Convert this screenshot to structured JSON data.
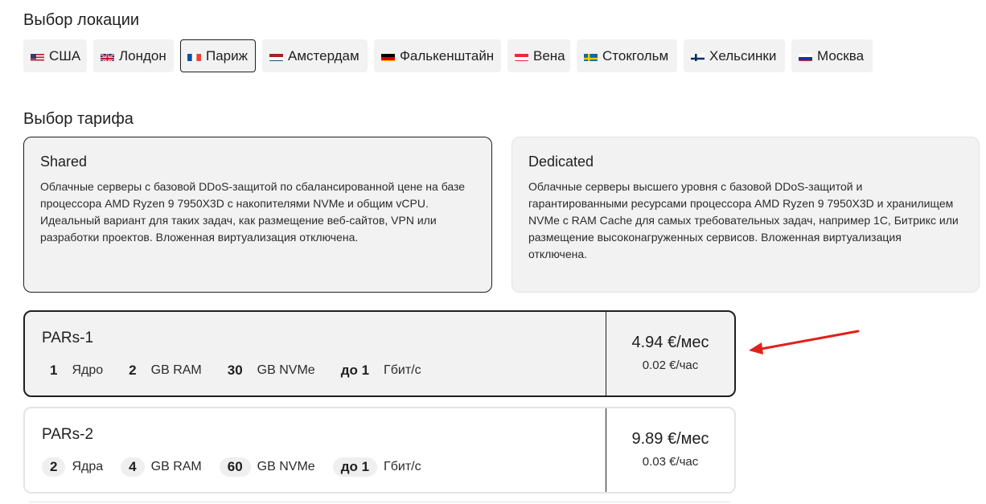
{
  "location_section": {
    "title": "Выбор локации",
    "items": [
      {
        "label": "США",
        "flag": "us-flag-icon"
      },
      {
        "label": "Лондон",
        "flag": "gb-flag-icon"
      },
      {
        "label": "Париж",
        "flag": "fr-flag-icon",
        "selected": true
      },
      {
        "label": "Амстердам",
        "flag": "nl-flag-icon"
      },
      {
        "label": "Фалькенштайн",
        "flag": "de-flag-icon"
      },
      {
        "label": "Вена",
        "flag": "at-flag-icon"
      },
      {
        "label": "Стокгольм",
        "flag": "se-flag-icon"
      },
      {
        "label": "Хельсинки",
        "flag": "fi-flag-icon"
      },
      {
        "label": "Москва",
        "flag": "ru-flag-icon"
      }
    ]
  },
  "plan_section": {
    "title": "Выбор тарифа",
    "types": [
      {
        "title": "Shared",
        "description": "Облачные серверы с базовой DDoS-защитой по сбалансированной цене на базе процессора AMD Ryzen 9 7950X3D с накопителями NVMe и общим vCPU. Идеальный вариант для таких задач, как размещение веб-сайтов, VPN или разработки проектов. Вложенная виртуализация отключена.",
        "selected": true
      },
      {
        "title": "Dedicated",
        "description": "Облачные серверы высшего уровня с базовой DDoS-защитой и гарантированными ресурсами процессора AMD Ryzen 9 7950X3D и хранилищем NVMe с RAM Cache для самых требовательных задач, например 1С, Битрикс или размещение высоконагруженных сервисов. Вложенная виртуализация отключена.",
        "selected": false
      }
    ]
  },
  "tariffs": [
    {
      "name": "PARs-1",
      "cpu": {
        "value": "1",
        "unit": "Ядро"
      },
      "ram": {
        "value": "2",
        "unit": "GB RAM"
      },
      "disk": {
        "value": "30",
        "unit": "GB NVMe"
      },
      "net": {
        "value": "до 1",
        "unit": "Гбит/с"
      },
      "price_month": "4.94 €/мес",
      "price_hour": "0.02 €/час",
      "selected": true
    },
    {
      "name": "PARs-2",
      "cpu": {
        "value": "2",
        "unit": "Ядра"
      },
      "ram": {
        "value": "4",
        "unit": "GB RAM"
      },
      "disk": {
        "value": "60",
        "unit": "GB NVMe"
      },
      "net": {
        "value": "до 1",
        "unit": "Гбит/с"
      },
      "price_month": "9.89 €/мес",
      "price_hour": "0.03 €/час",
      "selected": false
    }
  ],
  "annotation": {
    "arrow_color": "#e0201b",
    "icon": "red-arrow-icon"
  },
  "colors": {
    "border_dark": "#1f1f1f",
    "card_bg": "#f2f2f2"
  }
}
